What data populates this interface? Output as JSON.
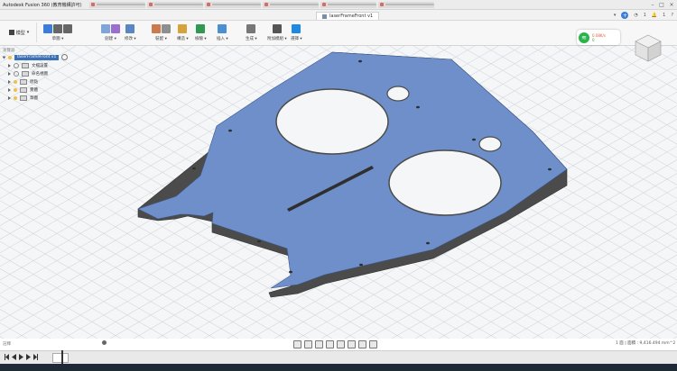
{
  "window": {
    "title": "Autodesk Fusion 360 (教育機構許可)",
    "browser_tab_count": 6
  },
  "document_tab": {
    "label": "laserFrameFront v1"
  },
  "tabrow_right": {
    "plus": "+",
    "counts": [
      "1",
      "1"
    ]
  },
  "workspace": {
    "label": "模型"
  },
  "toolbar_groups": [
    {
      "label": "草圖",
      "icons": [
        "sketch-icon",
        "undo-icon",
        "redo-icon"
      ]
    },
    {
      "label": "創建",
      "icons": [
        "box-icon",
        "grid-icon"
      ]
    },
    {
      "label": "修改",
      "icons": [
        "modify-icon"
      ]
    },
    {
      "label": "裝配",
      "icons": [
        "assemble-icon",
        "joint-icon"
      ]
    },
    {
      "label": "構造",
      "icons": [
        "plane-icon"
      ]
    },
    {
      "label": "檢驗",
      "icons": [
        "measure-icon"
      ]
    },
    {
      "label": "插入",
      "icons": [
        "image-insert-icon"
      ]
    },
    {
      "label": "生成",
      "icons": [
        "make-icon"
      ]
    },
    {
      "label": "附加模組",
      "icons": [
        "addins-icon"
      ]
    },
    {
      "label": "選擇",
      "icons": [
        "select-icon"
      ]
    }
  ],
  "browser": {
    "title": "瀏覽器",
    "root": "laserFrameFront v1",
    "items": [
      "文檔設置",
      "命名視圖",
      "原點",
      "實體",
      "草圖"
    ]
  },
  "network_speed": {
    "up": "0.08K/s",
    "down": "0"
  },
  "bottom": {
    "comment_label": "註釋",
    "status": "1 面 | 面積 : 9,416.494 mm^2"
  },
  "colors": {
    "part_top": "#6e8fc9",
    "part_side": "#4d4d4d",
    "accent": "#3b7dd8"
  }
}
